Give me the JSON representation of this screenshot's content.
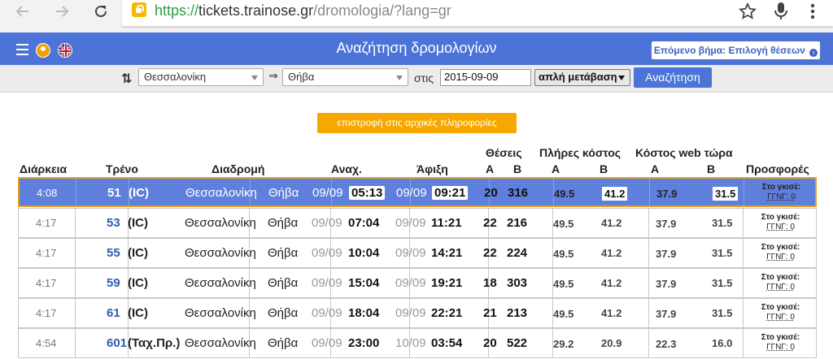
{
  "browser": {
    "url_scheme": "https://",
    "url_host": "tickets.trainose.gr",
    "url_path": "/dromologia/?lang=gr"
  },
  "header": {
    "title": "Αναζήτηση δρομολογίων",
    "next_step": "Επόμενο βήμα: Επιλογή θέσεων",
    "next_step_icon": "›"
  },
  "search": {
    "from": "Θεσσαλονίκη",
    "arrow": "⇒",
    "to": "Θήβα",
    "on_label": "στις",
    "date": "2015-09-09",
    "trip_type": "απλή μετάβαση",
    "search_button": "Αναζήτηση",
    "swap_icon": "⇅"
  },
  "back_button": "επιστροφή στις αρχικές πληροφορίες",
  "table": {
    "headers": {
      "duration": "Διάρκεια",
      "train": "Τρένο",
      "route": "Διαδρομή",
      "departure": "Αναχ.",
      "arrival": "Άφιξη",
      "seats": "Θέσεις",
      "full_cost": "Πλήρες κόστος",
      "web_cost": "Κόστος web τώρα",
      "offers": "Προσφορές",
      "class_a": "Α",
      "class_b": "Β"
    },
    "rows": [
      {
        "duration": "4:08",
        "train_no": "51",
        "train_type": "(IC)",
        "from": "Θεσσαλονίκη",
        "to": "Θήβα",
        "dep_date": "09/09",
        "dep_time": "05:13",
        "arr_date": "09/09",
        "arr_time": "09:21",
        "seats_a": "20",
        "seats_b": "316",
        "full_a": "49.5",
        "full_b": "41.2",
        "web_a": "37.9",
        "web_b": "31.5",
        "offer_label": "Στο γκισέ:",
        "offer_value": "ΓΓΝΓ: 0"
      },
      {
        "duration": "4:17",
        "train_no": "53",
        "train_type": "(IC)",
        "from": "Θεσσαλονίκη",
        "to": "Θήβα",
        "dep_date": "09/09",
        "dep_time": "07:04",
        "arr_date": "09/09",
        "arr_time": "11:21",
        "seats_a": "22",
        "seats_b": "216",
        "full_a": "49.5",
        "full_b": "41.2",
        "web_a": "37.9",
        "web_b": "31.5",
        "offer_label": "Στο γκισέ:",
        "offer_value": "ΓΓΝΓ: 0"
      },
      {
        "duration": "4:17",
        "train_no": "55",
        "train_type": "(IC)",
        "from": "Θεσσαλονίκη",
        "to": "Θήβα",
        "dep_date": "09/09",
        "dep_time": "10:04",
        "arr_date": "09/09",
        "arr_time": "14:21",
        "seats_a": "22",
        "seats_b": "224",
        "full_a": "49.5",
        "full_b": "41.2",
        "web_a": "37.9",
        "web_b": "31.5",
        "offer_label": "Στο γκισέ:",
        "offer_value": "ΓΓΝΓ: 0"
      },
      {
        "duration": "4:17",
        "train_no": "59",
        "train_type": "(IC)",
        "from": "Θεσσαλονίκη",
        "to": "Θήβα",
        "dep_date": "09/09",
        "dep_time": "15:04",
        "arr_date": "09/09",
        "arr_time": "19:21",
        "seats_a": "18",
        "seats_b": "303",
        "full_a": "49.5",
        "full_b": "41.2",
        "web_a": "37.9",
        "web_b": "31.5",
        "offer_label": "Στο γκισέ:",
        "offer_value": "ΓΓΝΓ: 0"
      },
      {
        "duration": "4:17",
        "train_no": "61",
        "train_type": "(IC)",
        "from": "Θεσσαλονίκη",
        "to": "Θήβα",
        "dep_date": "09/09",
        "dep_time": "18:04",
        "arr_date": "09/09",
        "arr_time": "22:21",
        "seats_a": "21",
        "seats_b": "213",
        "full_a": "49.5",
        "full_b": "41.2",
        "web_a": "37.9",
        "web_b": "31.5",
        "offer_label": "Στο γκισέ:",
        "offer_value": "ΓΓΝΓ: 0"
      },
      {
        "duration": "4:54",
        "train_no": "601",
        "train_type": "(Ταχ.Πρ.)",
        "from": "Θεσσαλονίκη",
        "to": "Θήβα",
        "dep_date": "09/09",
        "dep_time": "23:00",
        "arr_date": "10/09",
        "arr_time": "03:54",
        "seats_a": "20",
        "seats_b": "522",
        "full_a": "29.2",
        "full_b": "20.9",
        "web_a": "22.3",
        "web_b": "16.0",
        "offer_label": "Στο γκισέ:",
        "offer_value": "ΓΓΝΓ: 0"
      }
    ]
  },
  "colors": {
    "brand_blue": "#4c73d8",
    "selected_row": "#5f7fdc",
    "accent_orange": "#f7a800",
    "secure_green": "#2e9e3f"
  }
}
